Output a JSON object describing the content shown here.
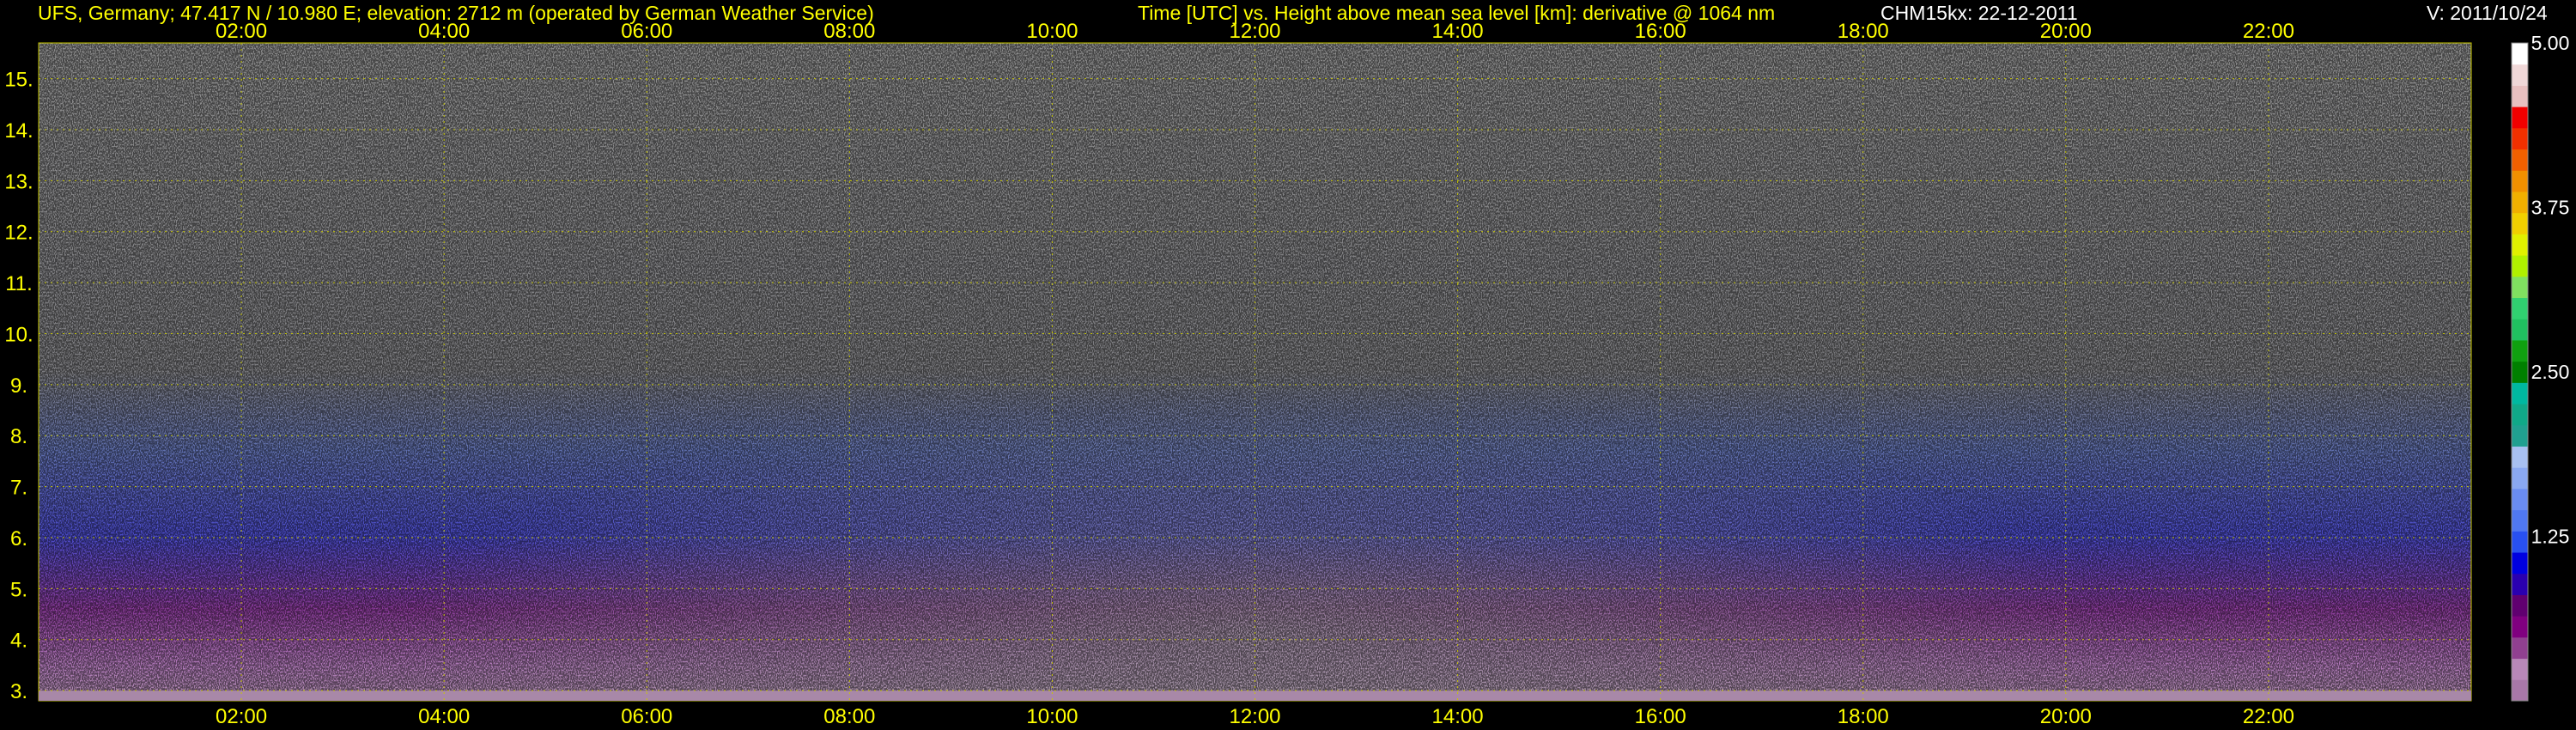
{
  "header": {
    "station": "UFS, Germany; 47.417 N / 10.980 E; elevation: 2712 m  (operated by German Weather Service)",
    "axes_title": "Time [UTC] vs. Height above mean sea level [km]: derivative @ 1064 nm",
    "instrument_date": "CHM15kx: 22-12-2011",
    "version": "V: 2011/10/24"
  },
  "colors": {
    "background": "#000000",
    "text": "#ffff00",
    "grid": "#c8c800",
    "version_text": "#ffffff"
  },
  "chart_data": {
    "type": "heatmap",
    "x_axis": {
      "label": "Time [UTC]",
      "range": [
        "00:00",
        "24:00"
      ],
      "ticks": [
        "02:00",
        "04:00",
        "06:00",
        "08:00",
        "10:00",
        "12:00",
        "14:00",
        "16:00",
        "18:00",
        "20:00",
        "22:00"
      ]
    },
    "y_axis": {
      "label": "Height above mean sea level [km]",
      "range": [
        2.8,
        15.7
      ],
      "ticks": [
        "3.",
        "4.",
        "5.",
        "6.",
        "7.",
        "8.",
        "9.",
        "10.",
        "11.",
        "12.",
        "13.",
        "14.",
        "15."
      ]
    },
    "colorbar": {
      "range": [
        0,
        5
      ],
      "labels": [
        "5.00",
        "3.75",
        "2.50",
        "1.25"
      ],
      "colors": [
        "#a878a8",
        "#b888b8",
        "#904090",
        "#800080",
        "#600070",
        "#2a00b0",
        "#0000e0",
        "#2850f0",
        "#5078f0",
        "#6a8cf0",
        "#8aa8f0",
        "#a8c0f0",
        "#20a090",
        "#10a888",
        "#00b8a0",
        "#008000",
        "#10a010",
        "#20c060",
        "#30d070",
        "#80e060",
        "#b0f000",
        "#e0f000",
        "#f0d000",
        "#f0b000",
        "#f09000",
        "#f06000",
        "#f03000",
        "#f00000",
        "#e8c0c0",
        "#f0d8d8",
        "#ffffff"
      ]
    },
    "signal_profile": {
      "description_free": true,
      "layers": [
        {
          "height_km": [
            3.0,
            4.5
          ],
          "colorbar_value": 0.3
        },
        {
          "height_km": [
            4.5,
            6.5
          ],
          "colorbar_value": 0.9
        },
        {
          "height_km": [
            6.5,
            8.5
          ],
          "colorbar_value": 1.5
        },
        {
          "height_km": [
            8.5,
            15.7
          ],
          "colorbar_value": 5.0
        }
      ]
    }
  }
}
